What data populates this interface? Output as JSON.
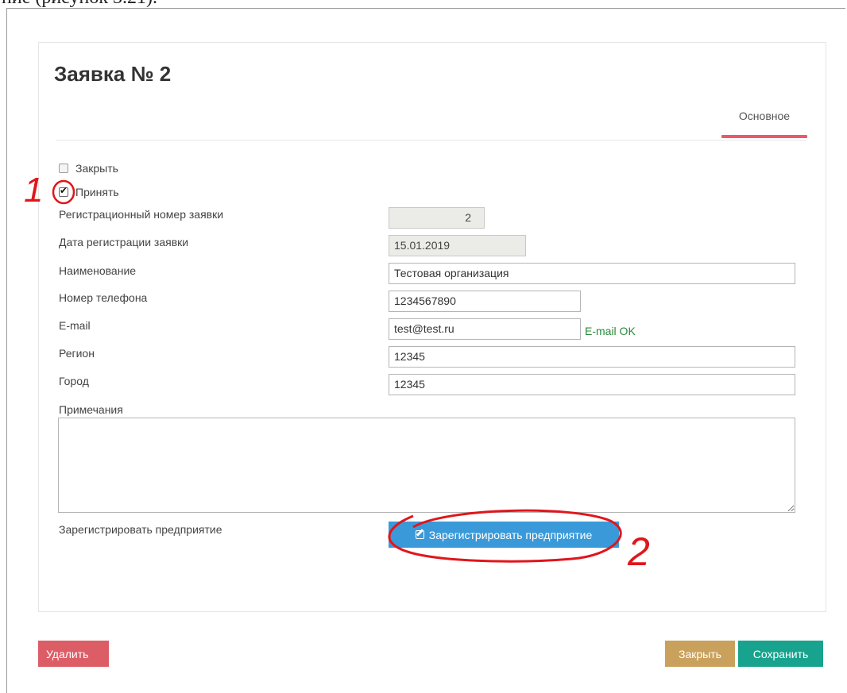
{
  "caption": "ние  (рисунок 3.21).",
  "form": {
    "title": "Заявка № 2",
    "tabs": [
      {
        "label": "Основное",
        "active": true
      }
    ],
    "checkboxes": [
      {
        "label": "Закрыть",
        "checked": false
      },
      {
        "label": "Принять",
        "checked": true
      }
    ],
    "fields": {
      "reg_number": {
        "label": "Регистрационный номер заявки",
        "value": "2"
      },
      "reg_date": {
        "label": "Дата регистрации заявки",
        "value": "15.01.2019"
      },
      "name": {
        "label": "Наименование",
        "value": "Тестовая организация"
      },
      "phone": {
        "label": "Номер телефона",
        "value": "1234567890"
      },
      "email": {
        "label": "E-mail",
        "value": "test@test.ru",
        "status": "E-mail OK"
      },
      "region": {
        "label": "Регион",
        "value": "12345"
      },
      "city": {
        "label": "Город",
        "value": "12345"
      },
      "notes": {
        "label": "Примечания",
        "value": ""
      }
    },
    "register": {
      "label": "Зарегистрировать предприятие",
      "button_label": "Зарегистрировать предприятие"
    }
  },
  "footer": {
    "delete_label": "Удалить",
    "close_label": "Закрыть",
    "save_label": "Сохранить"
  },
  "annotations": {
    "marker_1": "1",
    "marker_2": "2"
  },
  "colors": {
    "tab_underline": "#f0566a",
    "register_button": "#3a9ad9",
    "delete_button": "#dc5d66",
    "close_button": "#c9a15c",
    "save_button": "#17a38e",
    "email_ok": "#2a8a3a",
    "annotation": "#e0161b"
  }
}
